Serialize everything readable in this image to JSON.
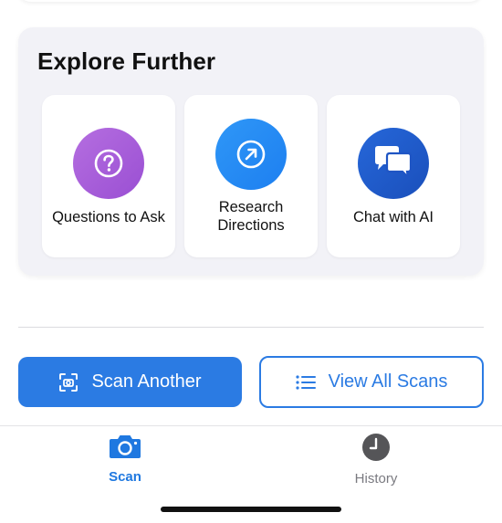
{
  "explore": {
    "title": "Explore Further",
    "tiles": [
      {
        "label": "Questions to Ask",
        "icon": "question-icon",
        "color": "#a95ddb"
      },
      {
        "label_line1": "Research",
        "label_line2": "Directions",
        "icon": "arrow-up-right-circle-icon",
        "color": "#2a8cf4"
      },
      {
        "label": "Chat with AI",
        "icon": "chat-bubbles-icon",
        "color": "#2159c9"
      }
    ]
  },
  "actions": {
    "scan_another": "Scan Another",
    "view_all": "View All Scans"
  },
  "tabbar": {
    "scan": "Scan",
    "history": "History"
  },
  "colors": {
    "accent": "#2b7be3",
    "tab_active": "#1f78e0",
    "tab_inactive": "#7a7a80"
  }
}
